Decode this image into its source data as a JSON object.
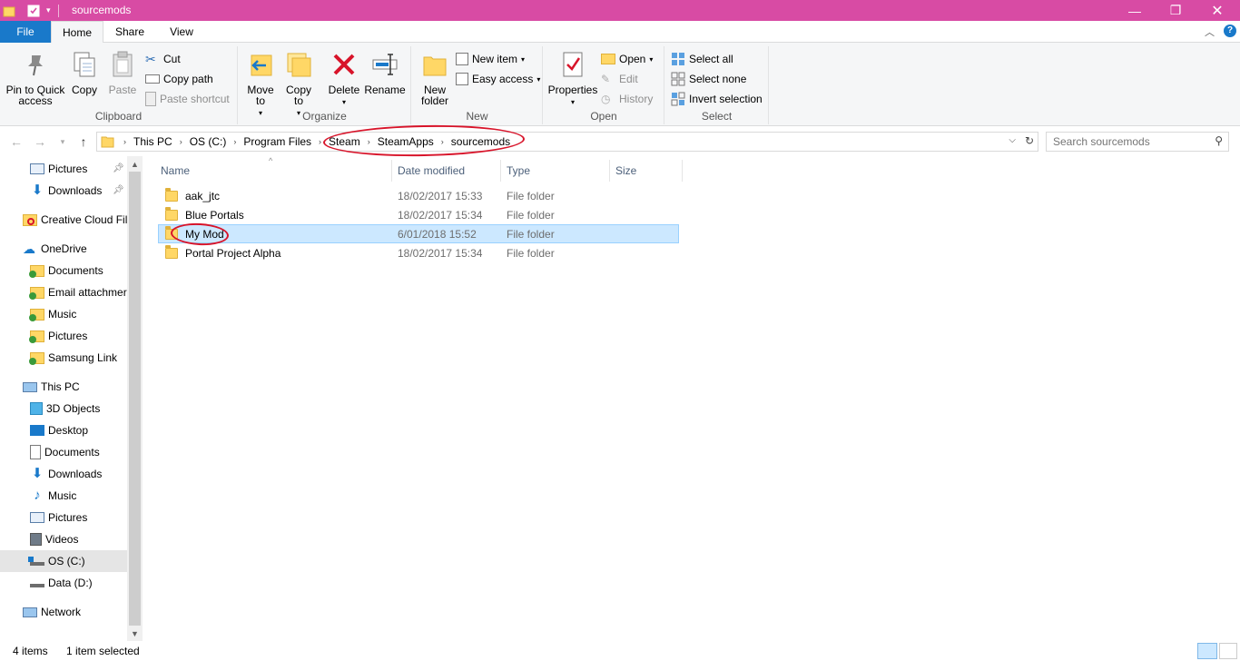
{
  "window": {
    "title": "sourcemods",
    "accent": "#d84ba4",
    "controls": [
      "minimize",
      "restore",
      "close"
    ]
  },
  "tabs": [
    {
      "label": "File"
    },
    {
      "label": "Home"
    },
    {
      "label": "Share"
    },
    {
      "label": "View"
    }
  ],
  "ribbon": {
    "clipboard": {
      "label": "Clipboard",
      "pin": "Pin to Quick access",
      "copy": "Copy",
      "paste": "Paste",
      "cut": "Cut",
      "copy_path": "Copy path",
      "paste_shortcut": "Paste shortcut"
    },
    "organize": {
      "label": "Organize",
      "move_to": "Move to",
      "copy_to": "Copy to",
      "delete": "Delete",
      "rename": "Rename"
    },
    "new": {
      "label": "New",
      "new_folder": "New folder",
      "new_item": "New item",
      "easy_access": "Easy access"
    },
    "open": {
      "label": "Open",
      "properties": "Properties",
      "open": "Open",
      "edit": "Edit",
      "history": "History"
    },
    "select": {
      "label": "Select",
      "select_all": "Select all",
      "select_none": "Select none",
      "invert": "Invert selection"
    }
  },
  "address": {
    "crumbs": [
      "This PC",
      "OS (C:)",
      "Program Files",
      "Steam",
      "SteamApps",
      "sourcemods"
    ],
    "search_placeholder": "Search sourcemods"
  },
  "nav": {
    "items": [
      {
        "label": "Pictures",
        "icon": "pictures-icon",
        "pinned": true
      },
      {
        "label": "Downloads",
        "icon": "downloads-icon",
        "pinned": true
      },
      {
        "label": "Creative Cloud Fil",
        "icon": "creative-cloud-icon"
      },
      {
        "label": "OneDrive",
        "icon": "onedrive-icon"
      },
      {
        "label": "Documents",
        "icon": "synced-folder-icon"
      },
      {
        "label": "Email attachmer",
        "icon": "synced-folder-icon"
      },
      {
        "label": "Music",
        "icon": "synced-folder-icon"
      },
      {
        "label": "Pictures",
        "icon": "synced-folder-icon"
      },
      {
        "label": "Samsung Link",
        "icon": "synced-folder-icon"
      },
      {
        "label": "This PC",
        "icon": "this-pc-icon"
      },
      {
        "label": "3D Objects",
        "icon": "3d-objects-icon"
      },
      {
        "label": "Desktop",
        "icon": "desktop-icon"
      },
      {
        "label": "Documents",
        "icon": "documents-icon"
      },
      {
        "label": "Downloads",
        "icon": "downloads-icon"
      },
      {
        "label": "Music",
        "icon": "music-icon"
      },
      {
        "label": "Pictures",
        "icon": "pictures-icon"
      },
      {
        "label": "Videos",
        "icon": "videos-icon"
      },
      {
        "label": "OS (C:)",
        "icon": "drive-c-icon",
        "selected": true
      },
      {
        "label": "Data (D:)",
        "icon": "drive-d-icon"
      },
      {
        "label": "Network",
        "icon": "network-icon"
      }
    ]
  },
  "columns": {
    "name": "Name",
    "date": "Date modified",
    "type": "Type",
    "size": "Size"
  },
  "files": [
    {
      "name": "aak_jtc",
      "date": "18/02/2017 15:33",
      "type": "File folder"
    },
    {
      "name": "Blue Portals",
      "date": "18/02/2017 15:34",
      "type": "File folder"
    },
    {
      "name": "My Mod",
      "date": "6/01/2018 15:52",
      "type": "File folder",
      "selected": true
    },
    {
      "name": "Portal Project Alpha",
      "date": "18/02/2017 15:34",
      "type": "File folder"
    }
  ],
  "status": {
    "count": "4 items",
    "selected": "1 item selected"
  }
}
